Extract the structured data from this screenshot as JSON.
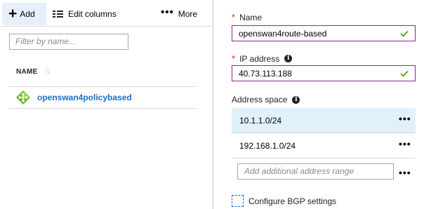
{
  "toolbar": {
    "add_label": "Add",
    "edit_columns_label": "Edit columns",
    "more_label": "More"
  },
  "filter": {
    "placeholder": "Filter by name..."
  },
  "list": {
    "column_header": "NAME",
    "items": [
      {
        "name": "openswan4policybased",
        "icon": "local-network-gateway-icon"
      }
    ]
  },
  "form": {
    "name": {
      "label": "Name",
      "required": true,
      "value": "openswan4route-based",
      "valid": true
    },
    "ip_address": {
      "label": "IP address",
      "required": true,
      "value": "40.73.113.188",
      "valid": true
    },
    "address_space": {
      "label": "Address space",
      "ranges": [
        "10.1.1.0/24",
        "192.168.1.0/24"
      ],
      "selected_index": 0,
      "add_placeholder": "Add additional address range"
    },
    "bgp": {
      "label": "Configure BGP settings",
      "checked": false
    }
  },
  "colors": {
    "accent_link": "#1c6ec4",
    "required_star": "#d12b2b",
    "field_border": "#7f2e86",
    "valid_check": "#57a300",
    "selected_row": "#e1f1fb",
    "toolbar_active": "#e7f0fa"
  }
}
